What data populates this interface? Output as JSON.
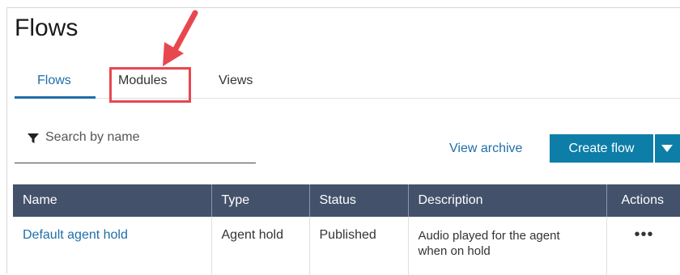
{
  "page": {
    "title": "Flows"
  },
  "tabs": [
    {
      "label": "Flows",
      "active": true
    },
    {
      "label": "Modules",
      "active": false,
      "highlighted": true
    },
    {
      "label": "Views",
      "active": false
    }
  ],
  "search": {
    "placeholder": "Search by name",
    "value": "",
    "icon": "filter-icon"
  },
  "toolbar": {
    "view_archive_label": "View archive",
    "create_flow_label": "Create flow",
    "dropdown_icon": "caret-down-icon"
  },
  "table": {
    "columns": [
      "Name",
      "Type",
      "Status",
      "Description",
      "Actions"
    ],
    "rows": [
      {
        "name": "Default agent hold",
        "type": "Agent hold",
        "status": "Published",
        "description": "Audio played for the agent when on hold",
        "actions": "•••"
      }
    ]
  },
  "colors": {
    "accent": "#1f6ea8",
    "primary_button": "#0d7ea8",
    "table_header": "#43526a",
    "annotation": "#e8474f"
  }
}
